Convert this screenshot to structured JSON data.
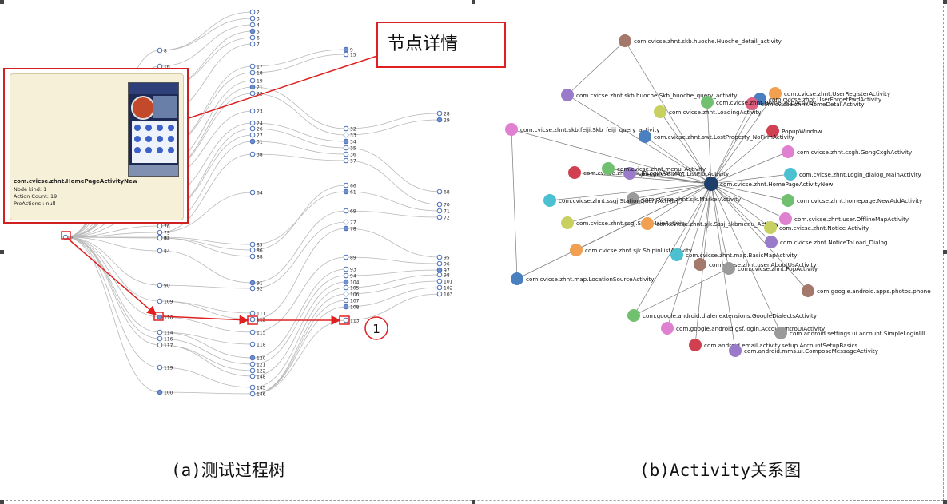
{
  "panel_a": {
    "caption": "(a)测试过程树",
    "callout_label": "节点详情",
    "marker_label": "1",
    "detail": {
      "title": "com.cvicse.zhnt.HomePageActivityNew",
      "node_kind": "Node kind: 1",
      "action_count": "Action Count: 19",
      "pre_actions": "PreActions : null"
    },
    "tree_labels": {
      "root": "0",
      "col1": [
        "8",
        "16",
        "20",
        "25",
        "30",
        "40",
        "41",
        "42",
        "65",
        "73",
        "76",
        "79",
        "82",
        "83",
        "84",
        "90",
        "109",
        "110",
        "114",
        "116",
        "117",
        "119",
        "100"
      ],
      "col2": [
        "2",
        "3",
        "4",
        "5",
        "6",
        "7",
        "17",
        "18",
        "19",
        "21",
        "22",
        "23",
        "24",
        "26",
        "27",
        "31",
        "38",
        "64",
        "85",
        "86",
        "88",
        "91",
        "92",
        "111",
        "112",
        "115",
        "118",
        "120",
        "121",
        "122",
        "148",
        "145",
        "146"
      ],
      "col3": [
        "9",
        "15",
        "32",
        "33",
        "34",
        "35",
        "36",
        "37",
        "61",
        "66",
        "69",
        "77",
        "78",
        "89",
        "93",
        "94",
        "104",
        "105",
        "106",
        "107",
        "108",
        "113"
      ],
      "col4": [
        "28",
        "29",
        "68",
        "70",
        "71",
        "72",
        "95",
        "96",
        "97",
        "98",
        "101",
        "102",
        "103"
      ]
    }
  },
  "panel_b": {
    "caption": "(b)Activity关系图",
    "center": "com.cvicse.zhnt.HomePageActivityNew",
    "nodes": [
      {
        "label": "com.cvicse.zhnt.skb.huoche.Huoche_detail_activity",
        "color": "#a4786a"
      },
      {
        "label": "com.cvicse.zhnt.skb.huoche.Skb_huoche_query_activity",
        "color": "#9a7bc9"
      },
      {
        "label": "com.cvicse.zhnt.UserRegisterActivity",
        "color": "#f0a050"
      },
      {
        "label": "com.cvicse.zhnt.UserForgetPwdActivity",
        "color": "#4a7fc0"
      },
      {
        "label": "com.cvicse.zhnt.HomeDetailActivity",
        "color": "#e06080"
      },
      {
        "label": "com.cvicse.zhnt.Home_PopActivity",
        "color": "#70c070"
      },
      {
        "label": "com.cvicse.zhnt.LoadingActivity",
        "color": "#c8d060"
      },
      {
        "label": "com.cvicse.zhnt.skb.feiji.Skb_feiji_query_activity",
        "color": "#e080d0"
      },
      {
        "label": "PopupWindow",
        "color": "#d04050"
      },
      {
        "label": "com.cvicse.zhnt.swt.LostProperty_NoFirmActivity",
        "color": "#4a7fc0"
      },
      {
        "label": "com.cvicse.zhnt.cxgh.GongCxghActivity",
        "color": "#e080d0"
      },
      {
        "label": "com.cvicse.zhnt.sjk.JPLoginActivity",
        "color": "#d04050"
      },
      {
        "label": "com.cvicse.zhnt.ListPlotActivity",
        "color": "#9a7bc9"
      },
      {
        "label": "com.cvicse.zhnt.menu_Activity",
        "color": "#70c070"
      },
      {
        "label": "com.cvicse.zhnt.Login_dialog_MainActivity",
        "color": "#4ac0d0"
      },
      {
        "label": "com.cvicse.zhnt.homepage.NewAddActivity",
        "color": "#70c070"
      },
      {
        "label": "com.cvicse.zhnt.sjk.MarkerActivity",
        "color": "#9a9a9a"
      },
      {
        "label": "com.cvicse.zhnt.ssgj.StationQueryActivity",
        "color": "#4ac0d0"
      },
      {
        "label": "com.cvicse.zhnt.user.OfflineMapActivity",
        "color": "#e080d0"
      },
      {
        "label": "com.cvicse.zhnt.ssgj.Sssj_MainActivity",
        "color": "#c8d060"
      },
      {
        "label": "com.cvicse.zhnt.sjk.Sssj_skbmenu_Activity",
        "color": "#f0a050"
      },
      {
        "label": "com.cvicse.zhnt.Notice Activity",
        "color": "#c8d060"
      },
      {
        "label": "com.cvicse.zhnt.NoticeToLoad_Dialog",
        "color": "#9a7bc9"
      },
      {
        "label": "com.cvicse.zhnt.sjk.ShipinListActivity",
        "color": "#f0a050"
      },
      {
        "label": "com.cvicse.zhnt.map.BasicMapActivity",
        "color": "#4ac0d0"
      },
      {
        "label": "com.cvicse.zhnt.user.AboutUsActivity",
        "color": "#a4786a"
      },
      {
        "label": "com.cvicse.zhnt.PopActivity",
        "color": "#9a9a9a"
      },
      {
        "label": "com.cvicse.zhnt.map.LocationSourceActivity",
        "color": "#4a7fc0"
      },
      {
        "label": "com.google.android.apps.photos.phone",
        "color": "#a4786a"
      },
      {
        "label": "com.google.android.dialer.extensions.GoogleDialectsActivity",
        "color": "#70c070"
      },
      {
        "label": "com.google.android.gsf.login.AccountIntroUIActivity",
        "color": "#e080d0"
      },
      {
        "label": "com.android.email.activity.setup.AccountSetupBasics",
        "color": "#d04050"
      },
      {
        "label": "com.android.mms.ui.ComposeMessageActivity",
        "color": "#9a7bc9"
      },
      {
        "label": "com.android.settings.ui.account.SimpleLoginUI",
        "color": "#9a9a9a"
      }
    ]
  }
}
